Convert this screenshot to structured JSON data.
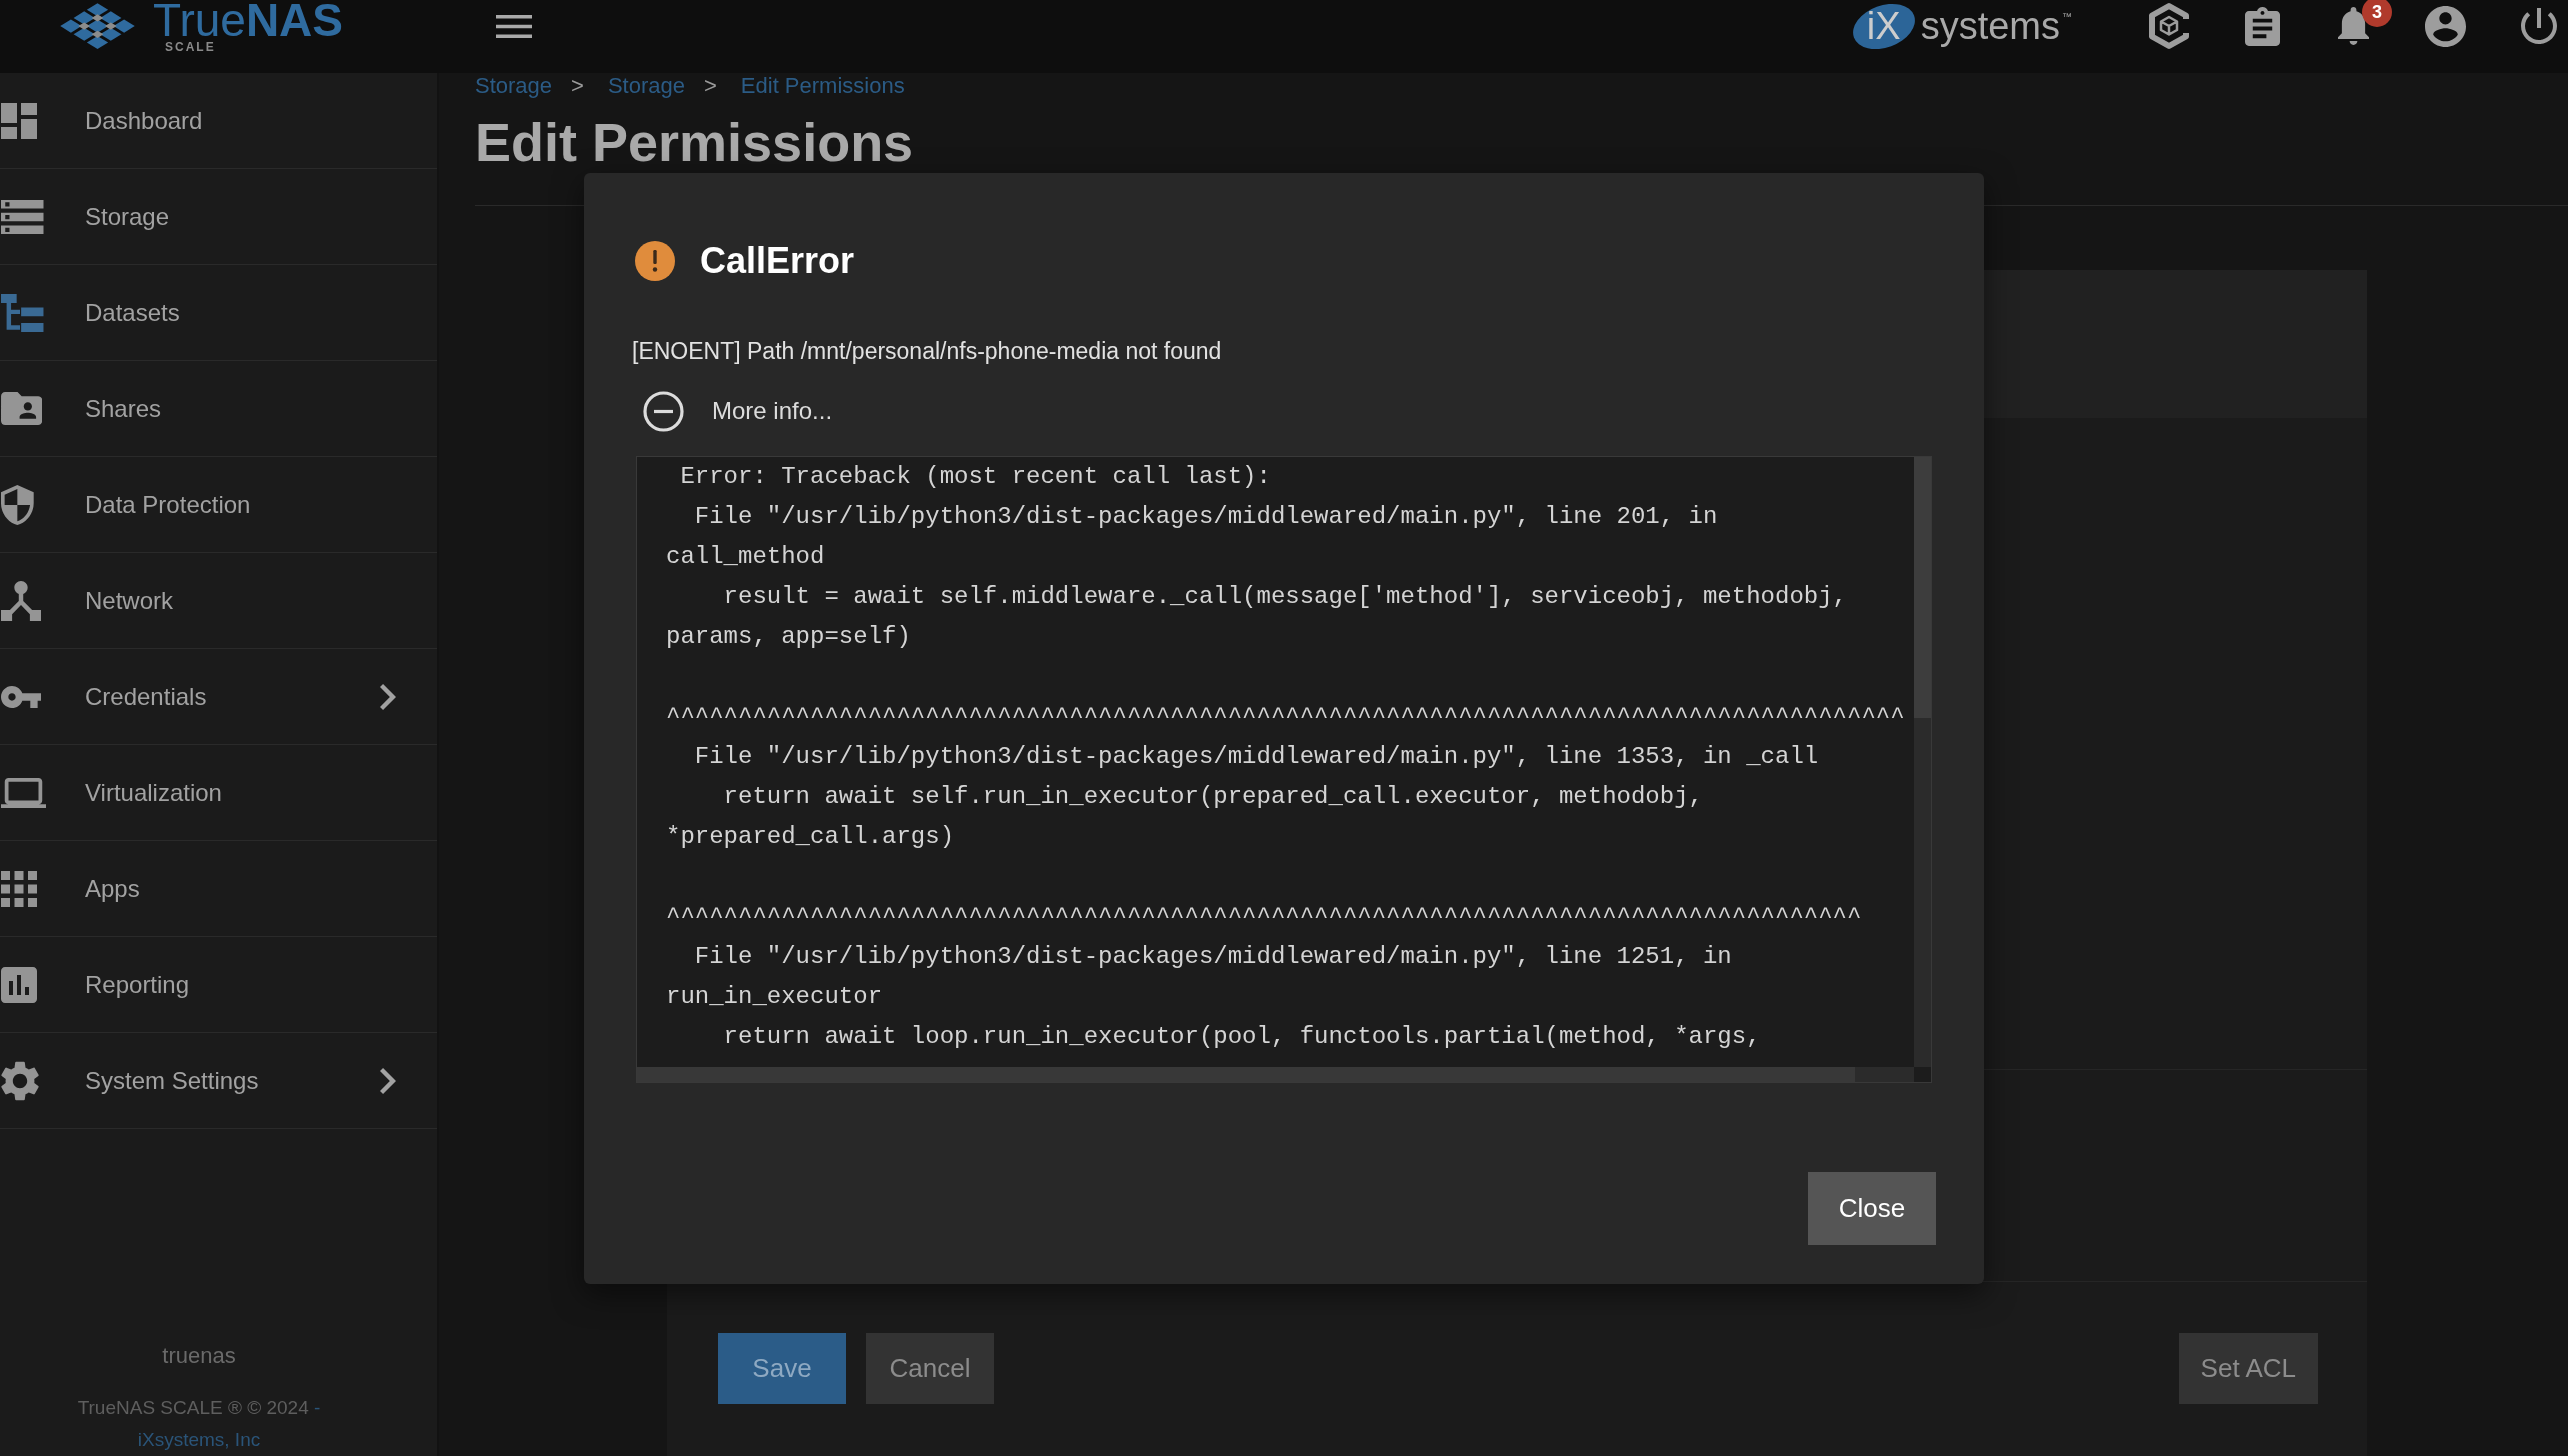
{
  "topbar": {
    "logo": {
      "name": "True**NAS**",
      "edition": "SCALE"
    },
    "vendor": {
      "mark": "iX",
      "name": "systems",
      "trademark": "™"
    },
    "notifications": {
      "count": "3"
    }
  },
  "sidebar": {
    "items": [
      {
        "label": "Dashboard",
        "submenu": false
      },
      {
        "label": "Storage",
        "submenu": false
      },
      {
        "label": "Datasets",
        "submenu": false
      },
      {
        "label": "Shares",
        "submenu": false
      },
      {
        "label": "Data Protection",
        "submenu": false
      },
      {
        "label": "Network",
        "submenu": false
      },
      {
        "label": "Credentials",
        "submenu": true
      },
      {
        "label": "Virtualization",
        "submenu": false
      },
      {
        "label": "Apps",
        "submenu": false
      },
      {
        "label": "Reporting",
        "submenu": false
      },
      {
        "label": "System Settings",
        "submenu": true
      }
    ],
    "hostname": "truenas",
    "copyright": "TrueNAS SCALE ® © 2024",
    "separator": "-",
    "link": "iXsystems, Inc"
  },
  "breadcrumb": [
    {
      "label": "Storage",
      "kind": "link"
    },
    {
      "label": ">",
      "kind": "separator"
    },
    {
      "label": "Storage",
      "kind": "link"
    },
    {
      "label": ">",
      "kind": "separator"
    },
    {
      "label": "Edit Permissions",
      "kind": "link"
    }
  ],
  "page": {
    "title": "Edit Permissions",
    "actions": [
      {
        "label": "Save",
        "kind": "primary"
      },
      {
        "label": "Cancel",
        "kind": "secondary"
      }
    ],
    "aside_actions": [
      {
        "label": "Set ACL",
        "kind": "secondary"
      }
    ]
  },
  "dialog": {
    "title": "CallError",
    "message": "[ENOENT] Path /mnt/personal/nfs-phone-media not found",
    "more_info": {
      "label": "More info...",
      "expanded": true
    },
    "traceback": " Error: Traceback (most recent call last):\n  File \"/usr/lib/python3/dist-packages/middlewared/main.py\", line 201, in\ncall_method\n    result = await self.middleware._call(message['method'], serviceobj, methodobj,\nparams, app=self)\n\n^^^^^^^^^^^^^^^^^^^^^^^^^^^^^^^^^^^^^^^^^^^^^^^^^^^^^^^^^^^^^^^^^^^^^^^^^^^^^^^^^^^^^^\n  File \"/usr/lib/python3/dist-packages/middlewared/main.py\", line 1353, in _call\n    return await self.run_in_executor(prepared_call.executor, methodobj,\n*prepared_call.args)\n\n^^^^^^^^^^^^^^^^^^^^^^^^^^^^^^^^^^^^^^^^^^^^^^^^^^^^^^^^^^^^^^^^^^^^^^^^^^^^^^^^^^^\n  File \"/usr/lib/python3/dist-packages/middlewared/main.py\", line 1251, in\nrun_in_executor\n    return await loop.run_in_executor(pool, functools.partial(method, *args,",
    "buttons": [
      {
        "label": "Close"
      }
    ]
  }
}
